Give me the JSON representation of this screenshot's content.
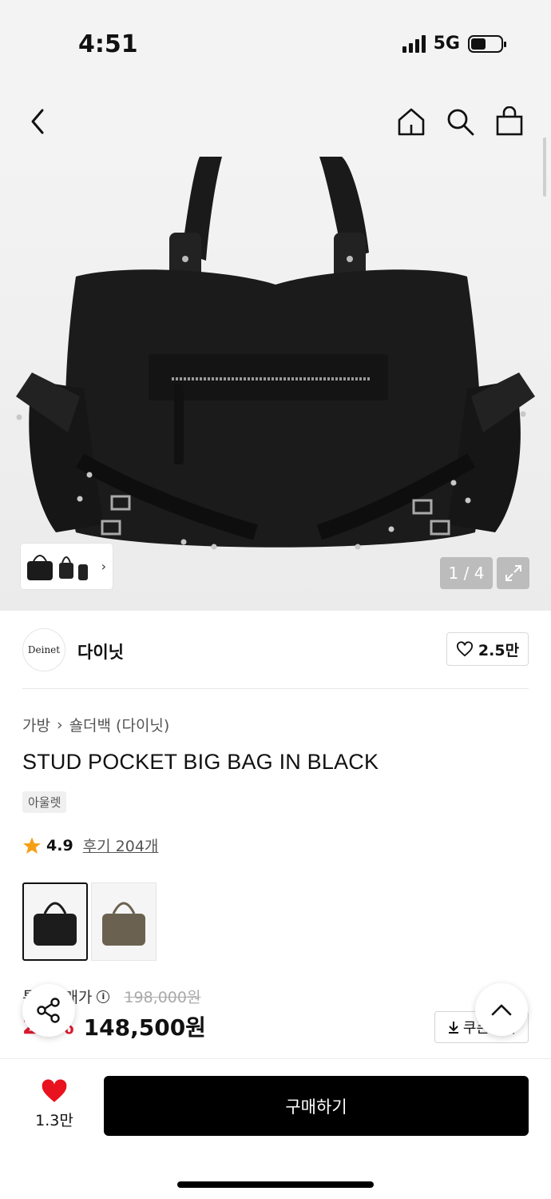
{
  "status": {
    "time": "4:51",
    "network": "5G",
    "battery_level": 0.5
  },
  "nav": {
    "icons": [
      "back-icon",
      "home-icon",
      "search-icon",
      "cart-icon"
    ]
  },
  "gallery": {
    "counter": "1 / 4"
  },
  "brand": {
    "logo_text": "Deinet",
    "name": "다이닛",
    "like_count": "2.5만"
  },
  "breadcrumb": {
    "category": "가방",
    "subcategory": "숄더백 (다이닛)"
  },
  "product": {
    "title": "STUD POCKET BIG BAG IN BLACK",
    "tag": "아울렛",
    "rating": "4.9",
    "reviews_label": "후기 204개",
    "colors": [
      {
        "name": "black",
        "hex": "#1c1c1c"
      },
      {
        "name": "khaki",
        "hex": "#6b6150"
      }
    ]
  },
  "price": {
    "label": "통합판매가",
    "original": "198,000원",
    "discount": "25%",
    "current": "148,500원",
    "coupon_label": "쿠폰받기"
  },
  "bottom": {
    "wish_count": "1.3만",
    "buy_label": "구매하기"
  },
  "colors": {
    "accent_red": "#e0182e",
    "heart_red": "#e8131e",
    "buy_bg": "#000000"
  }
}
